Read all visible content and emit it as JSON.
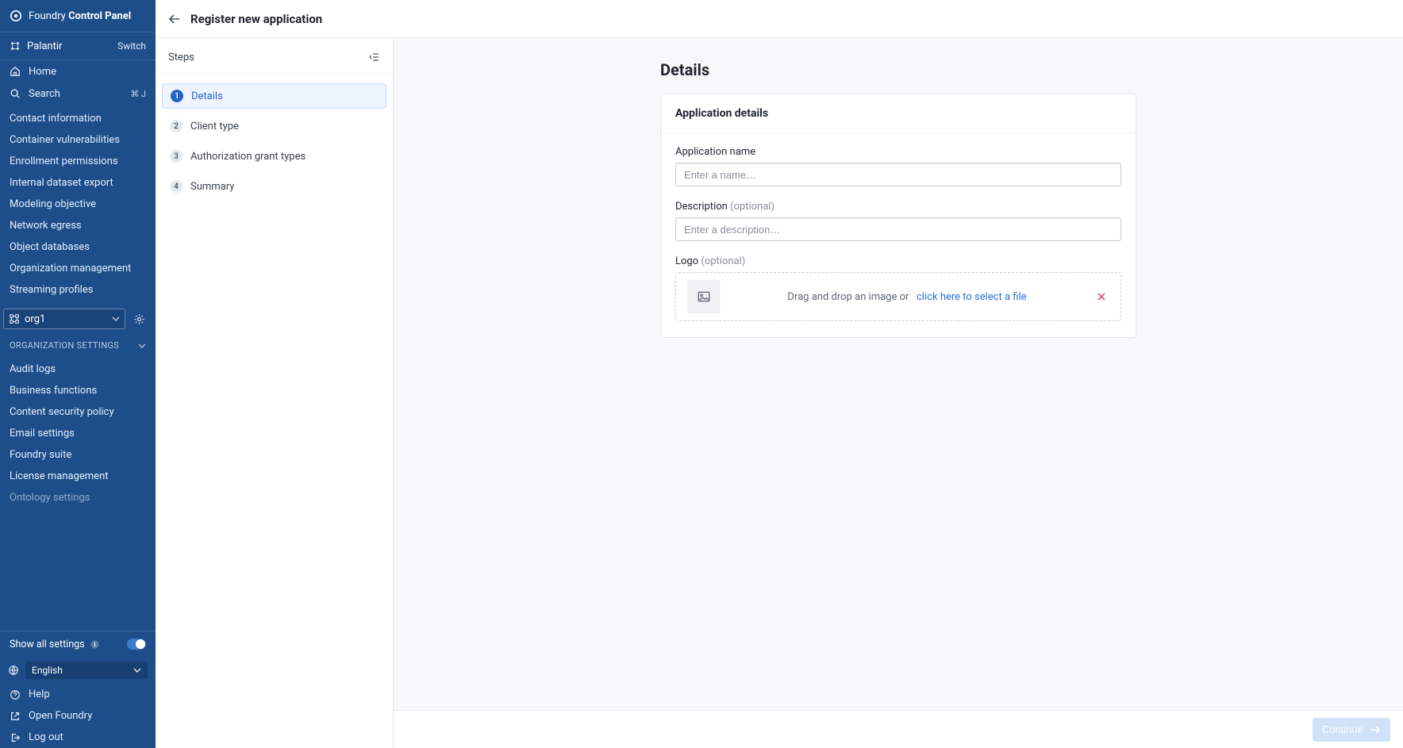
{
  "brand": {
    "light": "Foundry",
    "bold": "Control Panel"
  },
  "tenant": {
    "name": "Palantir",
    "switch": "Switch"
  },
  "nav": {
    "home": "Home",
    "search": "Search",
    "search_kbd": "⌘ J",
    "items": [
      "Contact information",
      "Container vulnerabilities",
      "Enrollment permissions",
      "Internal dataset export",
      "Modeling objective",
      "Network egress",
      "Object databases",
      "Organization management",
      "Streaming profiles"
    ]
  },
  "org_selector": {
    "value": "org1"
  },
  "org_section": {
    "title": "ORGANIZATION SETTINGS",
    "items": [
      "Audit logs",
      "Business functions",
      "Content security policy",
      "Email settings",
      "Foundry suite",
      "License management",
      "Ontology settings"
    ]
  },
  "sidebar_footer": {
    "show_all": "Show all settings",
    "language": "English",
    "help": "Help",
    "open_foundry": "Open Foundry",
    "logout": "Log out"
  },
  "topbar": {
    "title": "Register new application"
  },
  "steps": {
    "header": "Steps",
    "items": [
      {
        "num": "1",
        "label": "Details",
        "active": true
      },
      {
        "num": "2",
        "label": "Client type"
      },
      {
        "num": "3",
        "label": "Authorization grant types"
      },
      {
        "num": "4",
        "label": "Summary"
      }
    ]
  },
  "page": {
    "heading": "Details",
    "card_title": "Application details",
    "app_name_label": "Application name",
    "app_name_placeholder": "Enter a name…",
    "desc_label": "Description",
    "optional": "(optional)",
    "desc_placeholder": "Enter a description…",
    "logo_label": "Logo",
    "dropzone_text": "Drag and drop an image or",
    "dropzone_link": "click here to select a file"
  },
  "footer": {
    "continue": "Continue"
  }
}
